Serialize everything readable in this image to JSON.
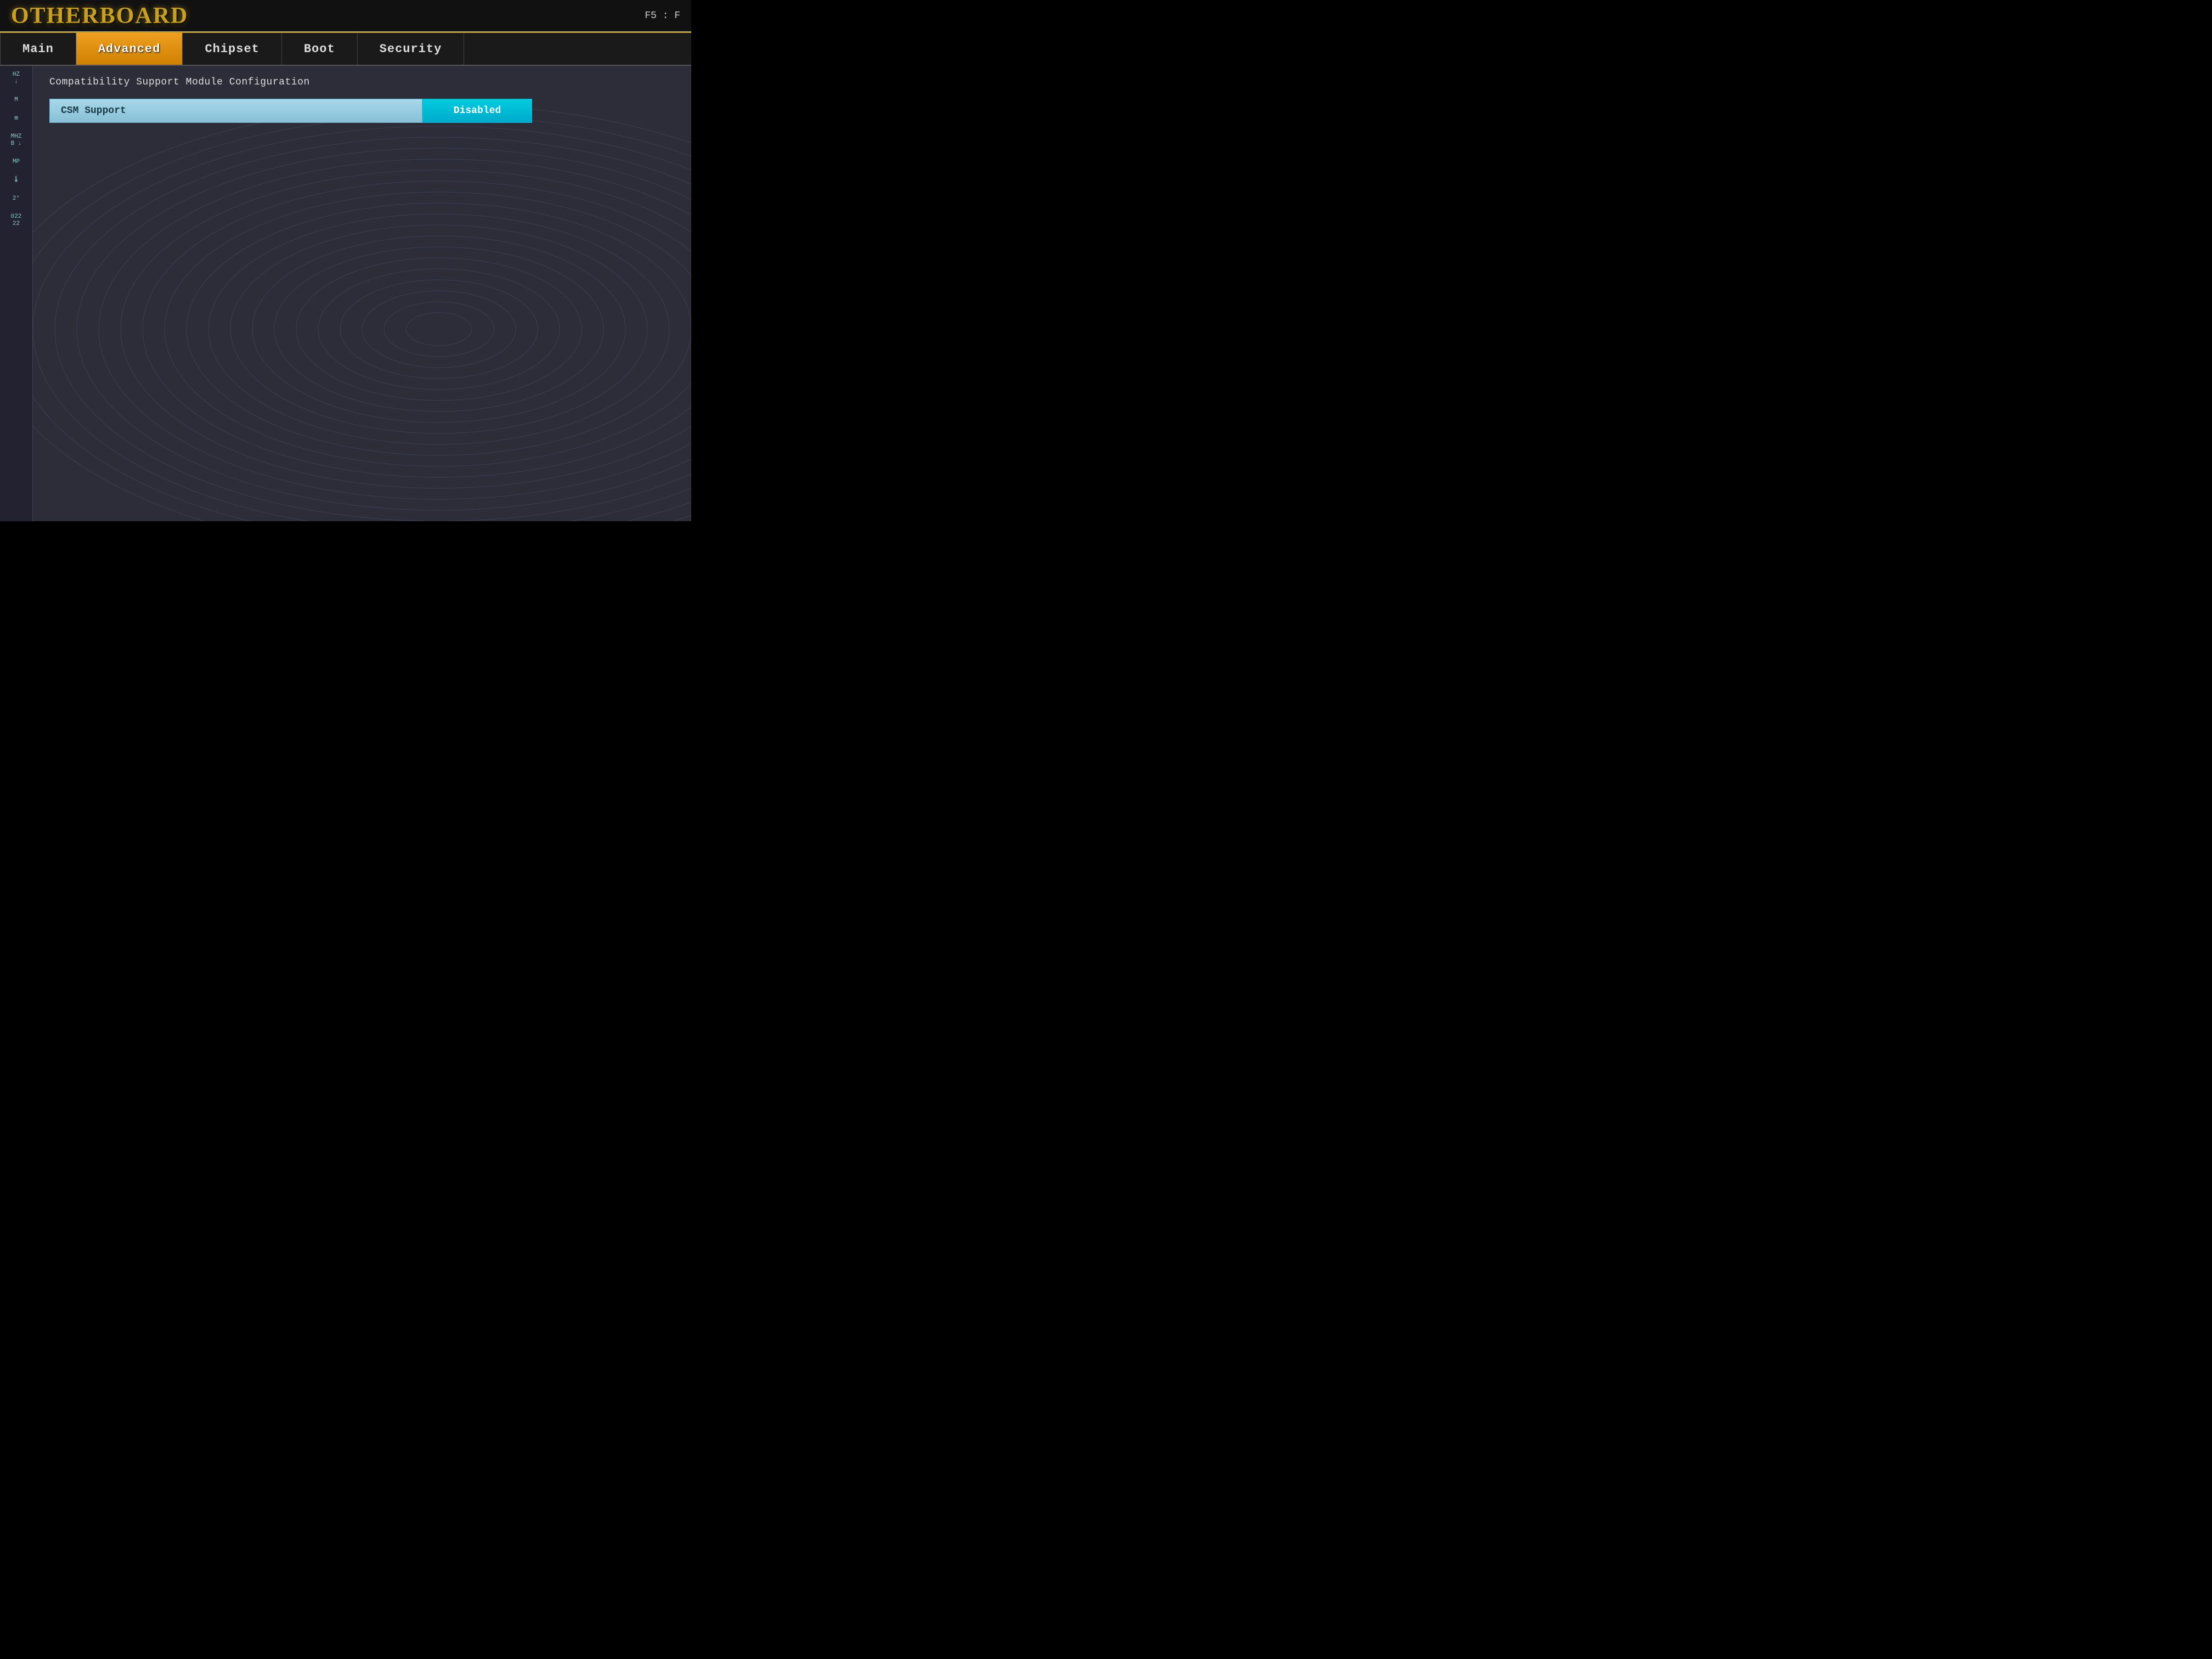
{
  "header": {
    "brand": "OTHERBOARD",
    "hint": "F5 : F"
  },
  "tabs": [
    {
      "id": "main",
      "label": "Main",
      "active": false
    },
    {
      "id": "advanced",
      "label": "Advanced",
      "active": true
    },
    {
      "id": "chipset",
      "label": "Chipset",
      "active": false
    },
    {
      "id": "boot",
      "label": "Boot",
      "active": false
    },
    {
      "id": "security",
      "label": "Security",
      "active": false
    }
  ],
  "sidebar_icons": [
    {
      "id": "hz-icon",
      "text": "HZ\n↓"
    },
    {
      "id": "m-icon",
      "text": "M"
    },
    {
      "id": "grid-icon",
      "text": "⊞"
    },
    {
      "id": "mhz-icon",
      "text": "MHZ\nB ↓"
    },
    {
      "id": "mp-icon",
      "text": "MP"
    },
    {
      "id": "temp-icon",
      "text": "🌡"
    },
    {
      "id": "num1-icon",
      "text": "2°"
    },
    {
      "id": "num2-icon",
      "text": "022\n22"
    }
  ],
  "content": {
    "section_title": "Compatibility Support Module Configuration",
    "settings": [
      {
        "id": "csm-support",
        "label": "CSM Support",
        "value": "Disabled"
      }
    ]
  }
}
